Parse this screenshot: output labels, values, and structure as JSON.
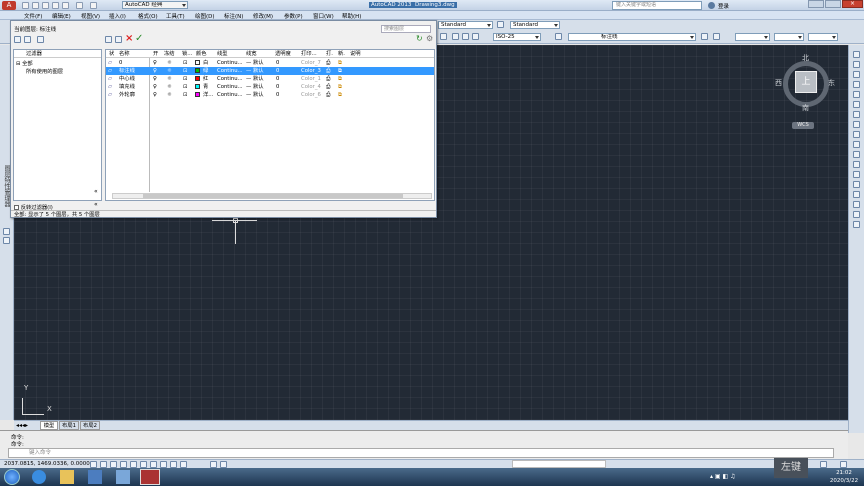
{
  "app": {
    "title_left": "AutoCAD 经典",
    "title_center": "AutoCAD 2013",
    "title_doc": "Drawing3.dwg",
    "search_placeholder": "键入关键字或短语",
    "login": "登录"
  },
  "menu": [
    "文件(F)",
    "编辑(E)",
    "视图(V)",
    "插入(I)",
    "格式(O)",
    "工具(T)",
    "绘图(D)",
    "标注(N)",
    "修改(M)",
    "参数(P)",
    "窗口(W)",
    "帮助(H)"
  ],
  "styles": {
    "text_style": "Standard",
    "dim_style": "Standard",
    "dim_scale": "ISO-25",
    "layer_combo": "标注线"
  },
  "layer_palette": {
    "current_layer": "当前图层: 标注线",
    "search_placeholder": "搜索图层",
    "filter_header": "过滤器",
    "tree_all": "全部",
    "tree_used": "所有使用的图层",
    "invert_filter": "反转过滤器(I)",
    "status": "全部: 显示了 5 个图层，共 5 个图层",
    "columns": [
      "状",
      "名称",
      "开",
      "冻结",
      "锁...",
      "颜色",
      "线型",
      "线宽",
      "透明度",
      "打印...",
      "打.",
      "新.",
      "说明"
    ],
    "rows": [
      {
        "name": "0",
        "color": "白",
        "color_hex": "#ffffff",
        "linetype": "Continu...",
        "lineweight": "— 默认",
        "transparency": "0",
        "plot_style": "Color_7"
      },
      {
        "name": "标注线",
        "color": "绿",
        "color_hex": "#00c000",
        "linetype": "Continu...",
        "lineweight": "— 默认",
        "transparency": "0",
        "plot_style": "Color_3"
      },
      {
        "name": "中心线",
        "color": "红",
        "color_hex": "#ff0000",
        "linetype": "Continu...",
        "lineweight": "— 默认",
        "transparency": "0",
        "plot_style": "Color_1"
      },
      {
        "name": "填充线",
        "color": "青",
        "color_hex": "#00ffff",
        "linetype": "Continu...",
        "lineweight": "— 默认",
        "transparency": "0",
        "plot_style": "Color_4"
      },
      {
        "name": "外轮廓",
        "color": "洋...",
        "color_hex": "#ff00ff",
        "linetype": "Continu...",
        "lineweight": "— 默认",
        "transparency": "0",
        "plot_style": "Color_6"
      }
    ],
    "side_label": "图层特性管理器"
  },
  "viewcube": {
    "north": "北",
    "south": "南",
    "east": "东",
    "west": "西",
    "top": "上",
    "wcs": "WCS"
  },
  "ucs": {
    "x": "X",
    "y": "Y"
  },
  "tabs": [
    "模型",
    "布局1",
    "布局2"
  ],
  "command": {
    "line1": "命令:",
    "line2": "命令:",
    "prompt": "键入命令"
  },
  "status": {
    "coords": "2037.0815, 1469.0336, 0.0000"
  },
  "taskbar": {
    "time": "21:02",
    "date": "2020/3/22",
    "watermark": "左键"
  }
}
